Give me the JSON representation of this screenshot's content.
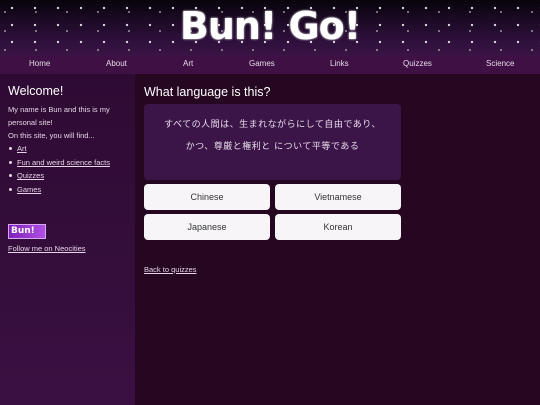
{
  "site": {
    "logo": "Bun! Go!"
  },
  "nav": {
    "items": [
      {
        "label": "Home"
      },
      {
        "label": "About"
      },
      {
        "label": "Art"
      },
      {
        "label": "Games"
      },
      {
        "label": "Links"
      },
      {
        "label": "Quizzes"
      },
      {
        "label": "Science"
      }
    ]
  },
  "sidebar": {
    "heading": "Welcome!",
    "intro_line1": "My name is Bun and this is my",
    "intro_line2": "personal site!",
    "intro_line3": "On this site, you will find...",
    "links": [
      {
        "label": "Art"
      },
      {
        "label": "Fun and weird science facts"
      },
      {
        "label": "Quizzes"
      },
      {
        "label": "Games"
      }
    ],
    "badge": "Bun!",
    "follow": "Follow me on Neocities"
  },
  "quiz": {
    "title": "What language is this?",
    "sentence_line1": "すべての人間は、生まれながらにして自由であり、",
    "sentence_line2": "かつ、尊厳と権利と について平等である",
    "answers": [
      {
        "label": "Chinese"
      },
      {
        "label": "Vietnamese"
      },
      {
        "label": "Japanese"
      },
      {
        "label": "Korean"
      }
    ],
    "back": "Back to quizzes"
  },
  "colors": {
    "page_bg": "#230720",
    "nav_bg": "#3e1044",
    "sidebar_bg": "#2e0b33",
    "sentence_bg": "#3c1548",
    "answer_bg": "#f7f5f8"
  }
}
